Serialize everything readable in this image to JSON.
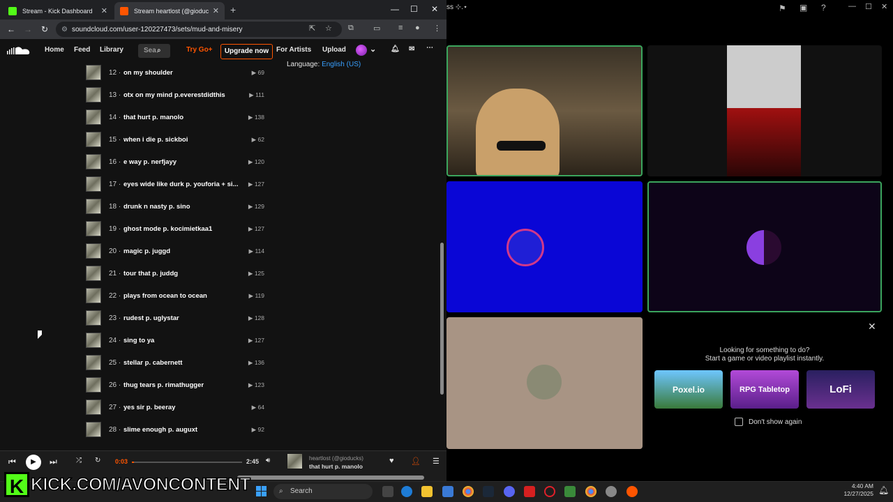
{
  "browser": {
    "tabs": [
      {
        "title": "Stream - Kick Dashboard"
      },
      {
        "title": "Stream heartlost (@gioducks) |"
      }
    ],
    "url": "soundcloud.com/user-120227473/sets/mud-and-misery"
  },
  "soundcloud": {
    "nav": {
      "home": "Home",
      "feed": "Feed",
      "library": "Library",
      "search_placeholder": "Sea",
      "try_go": "Try Go+",
      "upgrade": "Upgrade now",
      "for_artists": "For Artists",
      "upload": "Upload"
    },
    "language_label": "Language:",
    "language_value": "English (US)",
    "tracks": [
      {
        "num": "12",
        "name": "on my shoulder",
        "plays": "69"
      },
      {
        "num": "13",
        "name": "otx on my mind p.everestdidthis",
        "plays": "111"
      },
      {
        "num": "14",
        "name": "that hurt p. manolo",
        "plays": "138"
      },
      {
        "num": "15",
        "name": "when i die p. sickboi",
        "plays": "62"
      },
      {
        "num": "16",
        "name": "e way p. nerfjayy",
        "plays": "120"
      },
      {
        "num": "17",
        "name": "eyes wide like durk p. youforia + si...",
        "plays": "127"
      },
      {
        "num": "18",
        "name": "drunk n nasty p. sino",
        "plays": "129"
      },
      {
        "num": "19",
        "name": "ghost mode p. kocimietkaa1",
        "plays": "127"
      },
      {
        "num": "20",
        "name": "magic p. juggd",
        "plays": "114"
      },
      {
        "num": "21",
        "name": "tour that p. juddg",
        "plays": "125"
      },
      {
        "num": "22",
        "name": "plays from ocean to ocean",
        "plays": "119"
      },
      {
        "num": "23",
        "name": "rudest p. uglystar",
        "plays": "128"
      },
      {
        "num": "24",
        "name": "sing to ya",
        "plays": "127"
      },
      {
        "num": "25",
        "name": "stellar p. cabernett",
        "plays": "136"
      },
      {
        "num": "26",
        "name": "thug tears p. rimathugger",
        "plays": "123"
      },
      {
        "num": "27",
        "name": "yes sir p. beeray",
        "plays": "64"
      },
      {
        "num": "28",
        "name": "slime enough p. auguxt",
        "plays": "92"
      }
    ],
    "player": {
      "current_time": "0:03",
      "duration": "2:45",
      "progress": 0.02,
      "artist": "heartlost (@gioducks)",
      "track": "that hurt p. manolo"
    }
  },
  "discord": {
    "title_fragment": "ss ⊹.⋆",
    "activity": {
      "title_line1": "Looking for something to do?",
      "title_line2": "Start a game or video playlist instantly.",
      "cards": [
        "Poxel.io",
        "RPG Tabletop",
        "LoFi"
      ],
      "dont_show": "Don't show again"
    }
  },
  "overlay": {
    "kick_url": "KICK.COM/AVONCONTENT"
  },
  "taskbar": {
    "search": "Search",
    "time": "4:40 AM",
    "date": "12/27/2025"
  }
}
